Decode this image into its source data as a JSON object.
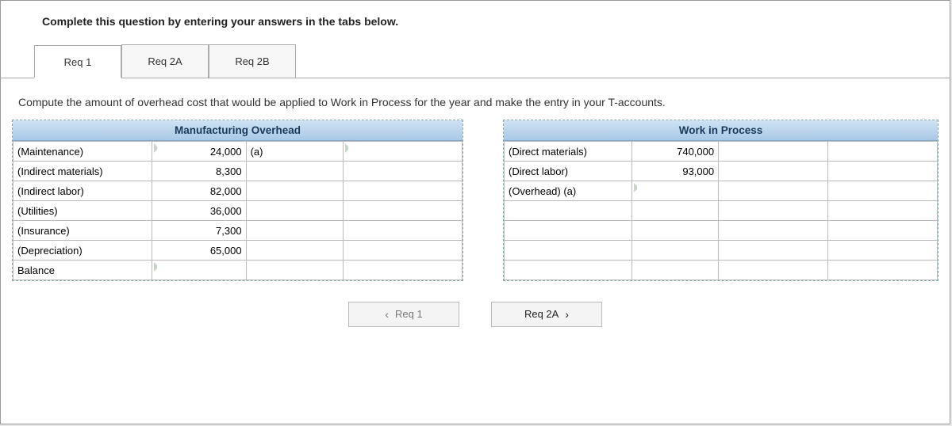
{
  "instruction": "Complete this question by entering your answers in the tabs below.",
  "tabs": {
    "t1": "Req 1",
    "t2": "Req 2A",
    "t3": "Req 2B"
  },
  "subinstruction": "Compute the amount of overhead cost that would be applied to Work in Process for the year and make the entry in your T-accounts.",
  "mo": {
    "title": "Manufacturing Overhead",
    "rows": [
      {
        "label": "(Maintenance)",
        "debit": "24,000",
        "note": "(a)",
        "credit": ""
      },
      {
        "label": "(Indirect materials)",
        "debit": "8,300",
        "note": "",
        "credit": ""
      },
      {
        "label": "(Indirect labor)",
        "debit": "82,000",
        "note": "",
        "credit": ""
      },
      {
        "label": "(Utilities)",
        "debit": "36,000",
        "note": "",
        "credit": ""
      },
      {
        "label": "(Insurance)",
        "debit": "7,300",
        "note": "",
        "credit": ""
      },
      {
        "label": "(Depreciation)",
        "debit": "65,000",
        "note": "",
        "credit": ""
      }
    ],
    "balance_label": "Balance"
  },
  "wip": {
    "title": "Work in Process",
    "rows": [
      {
        "label": "(Direct materials)",
        "debit": "740,000",
        "note": "",
        "credit": ""
      },
      {
        "label": "(Direct labor)",
        "debit": "93,000",
        "note": "",
        "credit": ""
      },
      {
        "label": "(Overhead) (a)",
        "debit": "",
        "note": "",
        "credit": ""
      }
    ]
  },
  "nav": {
    "prev": "Req 1",
    "next": "Req 2A"
  }
}
